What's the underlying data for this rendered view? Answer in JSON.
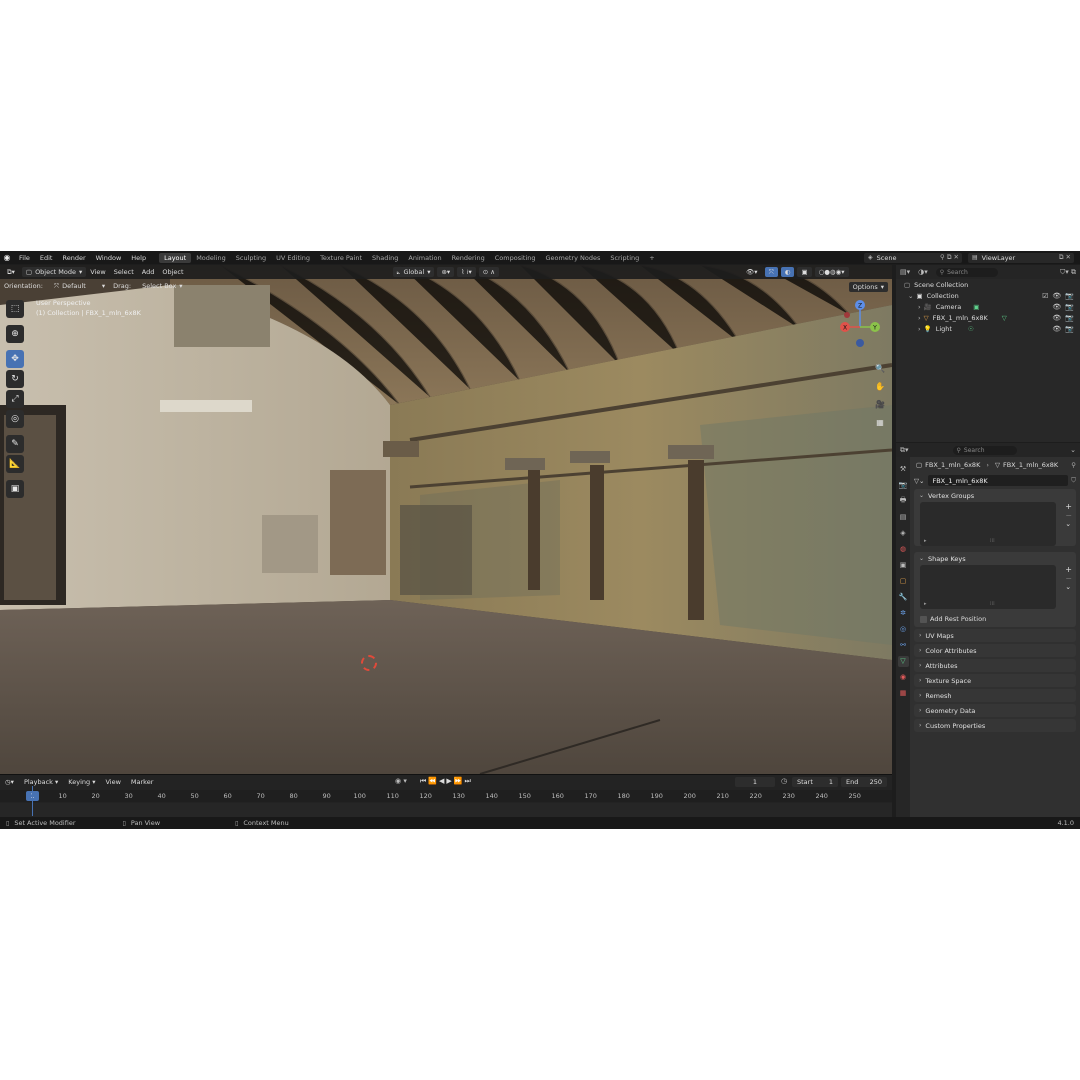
{
  "topbar": {
    "menus": [
      "File",
      "Edit",
      "Render",
      "Window",
      "Help"
    ],
    "workspaces": [
      "Layout",
      "Modeling",
      "Sculpting",
      "UV Editing",
      "Texture Paint",
      "Shading",
      "Animation",
      "Rendering",
      "Compositing",
      "Geometry Nodes",
      "Scripting"
    ],
    "active_workspace": "Layout",
    "add_tab": "+",
    "scene": "Scene",
    "view_layer": "ViewLayer"
  },
  "viewport": {
    "mode": "Object Mode",
    "menus": [
      "View",
      "Select",
      "Add",
      "Object"
    ],
    "transform_orientation": "Global",
    "orientation_label": "Orientation:",
    "orientation_value": "Default",
    "drag_label": "Drag:",
    "drag_value": "Select Box",
    "options": "Options",
    "overlay_line1": "User Perspective",
    "overlay_line2": "(1) Collection | FBX_1_mln_6x8K",
    "gizmo": {
      "z": "Z",
      "y": "Y",
      "x": "X"
    }
  },
  "timeline": {
    "menus": [
      "Playback",
      "Keying",
      "View",
      "Marker"
    ],
    "current_frame": "1",
    "start_label": "Start",
    "start_value": "1",
    "end_label": "End",
    "end_value": "250",
    "ticks": [
      "10",
      "20",
      "30",
      "40",
      "50",
      "60",
      "70",
      "80",
      "90",
      "100",
      "110",
      "120",
      "130",
      "140",
      "150",
      "160",
      "170",
      "180",
      "190",
      "200",
      "210",
      "220",
      "230",
      "240",
      "250"
    ]
  },
  "statusbar": {
    "left": "Set Active Modifier",
    "middle": "Pan View",
    "right": "Context Menu",
    "version": "4.1.0"
  },
  "outliner": {
    "search_placeholder": "Search",
    "scene_collection": "Scene Collection",
    "collection": "Collection",
    "items": [
      {
        "label": "Camera",
        "icon": "camera-icon",
        "color": "#e2a04a"
      },
      {
        "label": "FBX_1_mln_6x8K",
        "icon": "mesh-icon",
        "color": "#e2a04a"
      },
      {
        "label": "Light",
        "icon": "light-icon",
        "color": "#e2a04a"
      }
    ]
  },
  "properties": {
    "search_placeholder": "Search",
    "breadcrumb_object": "FBX_1_mln_6x8K",
    "breadcrumb_mesh": "FBX_1_mln_6x8K",
    "mesh_name": "FBX_1_mln_6x8K",
    "vertex_groups": "Vertex Groups",
    "shape_keys": "Shape Keys",
    "add_rest_position": "Add Rest Position",
    "collapsed_panels": [
      "UV Maps",
      "Color Attributes",
      "Attributes",
      "Texture Space",
      "Remesh",
      "Geometry Data",
      "Custom Properties"
    ]
  },
  "colors": {
    "accent": "#4772b3",
    "object_orange": "#e2a04a",
    "data_green": "#5fd38d"
  }
}
